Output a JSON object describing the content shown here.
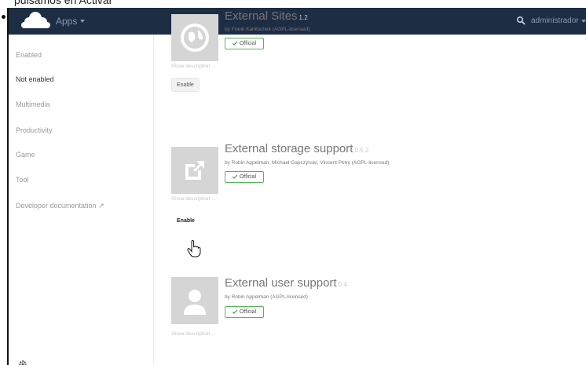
{
  "caption": {
    "text": "pulsamos en Activar"
  },
  "topbar": {
    "logo_icon": "owncloud-logo-icon",
    "apps_label": "Apps",
    "search_icon": "search-icon",
    "user_label": "administrador"
  },
  "sidebar": {
    "items": [
      {
        "label": "Enabled",
        "active": false
      },
      {
        "label": "Not enabled",
        "active": true
      },
      {
        "label": "Multimedia",
        "active": false
      },
      {
        "label": "Productivity",
        "active": false
      },
      {
        "label": "Game",
        "active": false
      },
      {
        "label": "Tool",
        "active": false
      },
      {
        "label": "Developer documentation ↗",
        "active": false
      }
    ],
    "settings_icon": "gear-icon"
  },
  "apps": [
    {
      "title": "External Sites",
      "version": "1.2",
      "author": "by Frank Karlitschek (AGPL-licensed)",
      "badge": "Official",
      "show_description": "Show description ...",
      "button": "Enable",
      "icon": "globe-icon"
    },
    {
      "title": "External storage support",
      "version": "0.5.2",
      "author": "by Robin Appelman, Michael Gapczynski, Vincent Petry (AGPL-licensed)",
      "badge": "Official",
      "show_description": "Show description ...",
      "button": "Enable",
      "icon": "external-link-icon"
    },
    {
      "title": "External user support",
      "version": "0.4",
      "author": "by Robin Appelman (AGPL-licensed)",
      "badge": "Official",
      "show_description": "Show description ...",
      "icon": "user-icon"
    }
  ],
  "colors": {
    "topbar": "#1d2d44",
    "official_green": "#59b35a",
    "icon_gray": "#d5d5d5"
  }
}
